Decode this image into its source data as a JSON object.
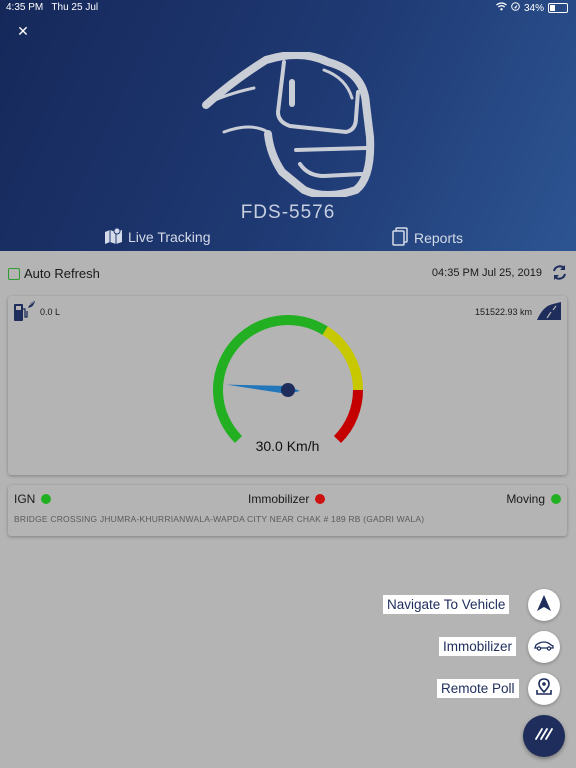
{
  "status_bar": {
    "time": "4:35 PM",
    "date": "Thu 25 Jul",
    "battery": "34%",
    "battery_level": 0.34
  },
  "header": {
    "close_icon": "close-icon",
    "plate": "FDS-5576",
    "tabs": [
      {
        "label": "Live Tracking",
        "icon": "map-icon"
      },
      {
        "label": "Reports",
        "icon": "documents-icon"
      }
    ]
  },
  "info": {
    "auto_refresh_label": "Auto Refresh",
    "auto_refresh_checked": false,
    "timestamp": "04:35 PM Jul 25, 2019"
  },
  "gauge": {
    "fuel": "0.0 L",
    "odometer": "151522.93 km",
    "speed_text": "30.0 Km/h",
    "speed_value": 30.0,
    "colors": {
      "green": "#22b022",
      "yellow": "#c8c800",
      "red": "#c40000",
      "needle": "#2277bb",
      "hub": "#1e2d5c"
    }
  },
  "status": {
    "ign_label": "IGN",
    "ign_color": "#22b022",
    "immobilizer_label": "Immobilizer",
    "immobilizer_color": "#cc1111",
    "moving_label": "Moving",
    "moving_color": "#22b022",
    "address": "BRIDGE CROSSING JHUMRA-KHURRIANWALA-WAPDA CITY NEAR CHAK # 189 RB (GADRI WALA)"
  },
  "actions": [
    {
      "label": "Navigate To Vehicle",
      "icon": "navigation-arrow-icon"
    },
    {
      "label": "Immobilizer",
      "icon": "car-icon"
    },
    {
      "label": "Remote Poll",
      "icon": "location-pin-icon"
    }
  ],
  "accent": "#1e2d5c"
}
